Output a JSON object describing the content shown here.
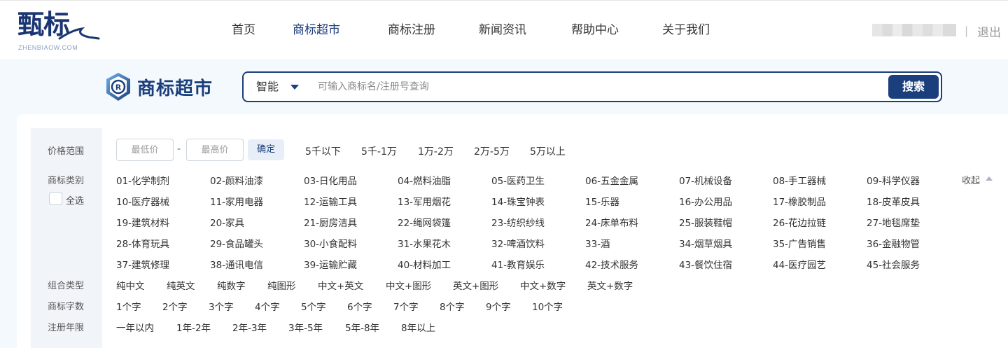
{
  "logo": {
    "mark": "甄标",
    "subtitle": "ZHENBIAOW.COM"
  },
  "nav": [
    "首页",
    "商标超市",
    "商标注册",
    "新闻资讯",
    "帮助中心",
    "关于我们"
  ],
  "nav_active": "商标超市",
  "header_right": {
    "separator": "|",
    "logout": "退出"
  },
  "band": {
    "title": "商标超市"
  },
  "search": {
    "mode": "智能",
    "placeholder": "可输入商标名/注册号查询",
    "button": "搜索"
  },
  "filters": {
    "price": {
      "label": "价格范围",
      "min_placeholder": "最低价",
      "dash": "-",
      "max_placeholder": "最高价",
      "confirm": "确定",
      "options": [
        "5千以下",
        "5千-1万",
        "1万-2万",
        "2万-5万",
        "5万以上"
      ]
    },
    "category": {
      "label": "商标类别",
      "select_all": "全选",
      "collapse": "收起",
      "items": [
        "01-化学制剂",
        "02-颜料油漆",
        "03-日化用品",
        "04-燃料油脂",
        "05-医药卫生",
        "06-五金金属",
        "07-机械设备",
        "08-手工器械",
        "09-科学仪器",
        "10-医疗器械",
        "11-家用电器",
        "12-运输工具",
        "13-军用烟花",
        "14-珠宝钟表",
        "15-乐器",
        "16-办公用品",
        "17-橡胶制品",
        "18-皮革皮具",
        "19-建筑材料",
        "20-家具",
        "21-厨房洁具",
        "22-绳网袋篷",
        "23-纺织纱线",
        "24-床单布料",
        "25-服装鞋帽",
        "26-花边拉链",
        "27-地毯席垫",
        "28-体育玩具",
        "29-食品罐头",
        "30-小食配料",
        "31-水果花木",
        "32-啤酒饮料",
        "33-酒",
        "34-烟草烟具",
        "35-广告销售",
        "36-金融物管",
        "37-建筑修理",
        "38-通讯电信",
        "39-运输贮藏",
        "40-材料加工",
        "41-教育娱乐",
        "42-技术服务",
        "43-餐饮住宿",
        "44-医疗园艺",
        "45-社会服务"
      ]
    },
    "combo": {
      "label": "组合类型",
      "options": [
        "纯中文",
        "纯英文",
        "纯数字",
        "纯图形",
        "中文+英文",
        "中文+图形",
        "英文+图形",
        "中文+数字",
        "英文+数字"
      ]
    },
    "char_count": {
      "label": "商标字数",
      "options": [
        "1个字",
        "2个字",
        "3个字",
        "4个字",
        "5个字",
        "6个字",
        "7个字",
        "8个字",
        "9个字",
        "10个字"
      ]
    },
    "reg_years": {
      "label": "注册年限",
      "options": [
        "一年以内",
        "1年-2年",
        "2年-3年",
        "3年-5年",
        "5年-8年",
        "8年以上"
      ]
    }
  },
  "colors": {
    "brand": "#1b3e7c",
    "page_bg": "#f3f9fd",
    "label_bg": "#f1f5fa"
  }
}
